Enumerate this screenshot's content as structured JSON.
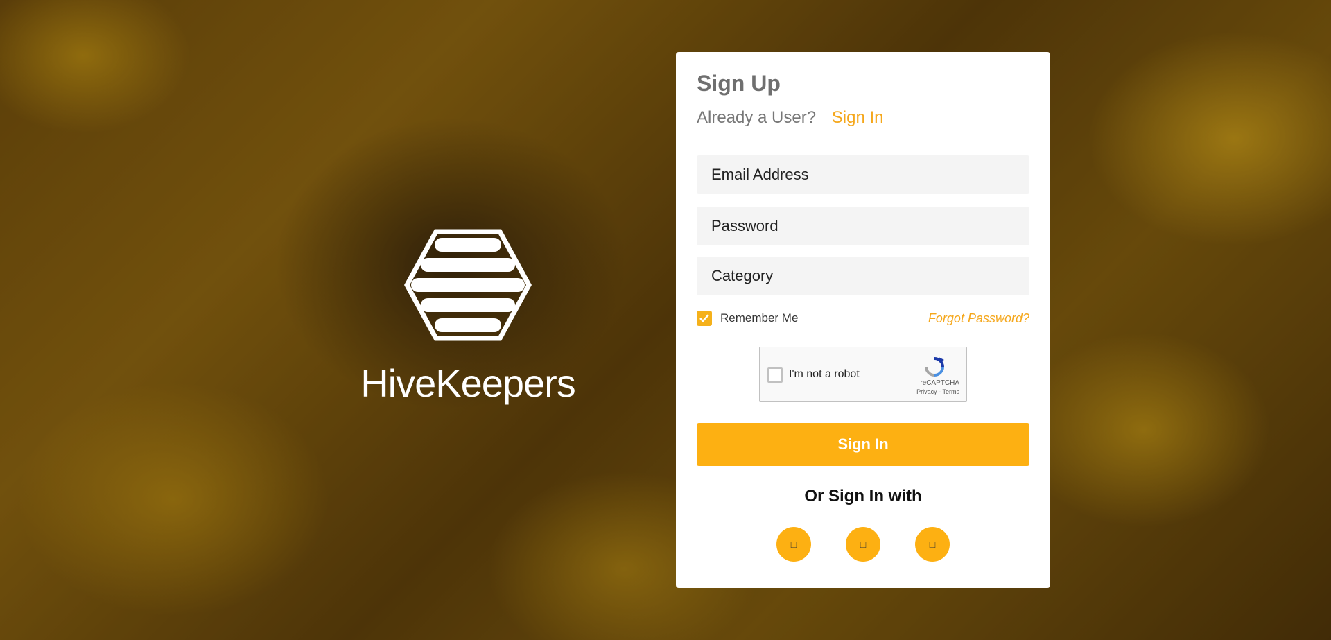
{
  "brand": {
    "name": "HiveKeepers",
    "logo_icon": "hexagon-hive-icon"
  },
  "form": {
    "title": "Sign Up",
    "already_user_text": "Already a User?",
    "signin_link": "Sign In",
    "email_placeholder": "Email Address",
    "password_placeholder": "Password",
    "category_placeholder": "Category",
    "remember_label": "Remember Me",
    "remember_checked": true,
    "forgot_label": "Forgot Password?",
    "submit_label": "Sign In",
    "or_text": "Or Sign In with"
  },
  "recaptcha": {
    "label": "I'm not a robot",
    "brand": "reCAPTCHA",
    "terms": "Privacy - Terms"
  },
  "social": [
    {
      "icon": "social-icon-1",
      "glyph": "□"
    },
    {
      "icon": "social-icon-2",
      "glyph": "□"
    },
    {
      "icon": "social-icon-3",
      "glyph": "□"
    }
  ],
  "colors": {
    "accent": "#fdb012",
    "link": "#f5a71b",
    "title": "#6f6f6f",
    "field_bg": "#f4f4f4"
  }
}
